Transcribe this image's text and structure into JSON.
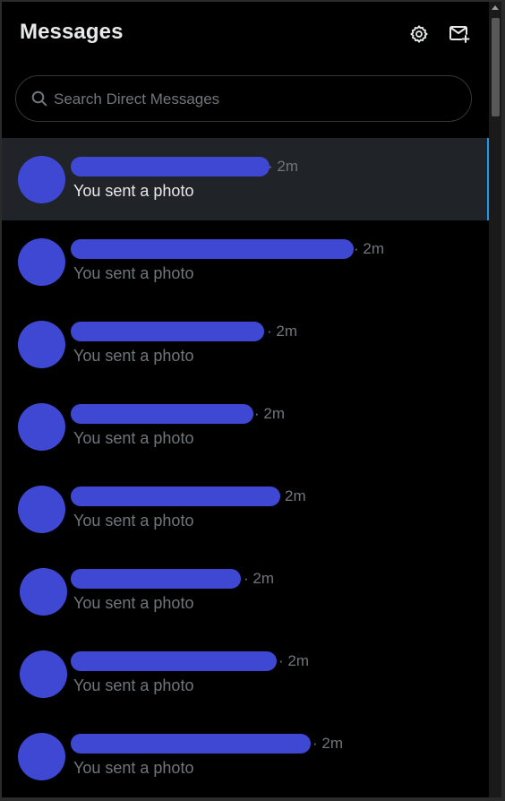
{
  "header": {
    "title": "Messages",
    "settings_icon": "gear-icon",
    "new_message_icon": "new-message-icon"
  },
  "search": {
    "placeholder": "Search Direct Messages",
    "icon": "search-icon"
  },
  "conversations": [
    {
      "time": "· 2m",
      "preview": "You sent a photo",
      "selected": true
    },
    {
      "time": "· 2m",
      "preview": "You sent a photo",
      "selected": false
    },
    {
      "time": "· 2m",
      "preview": "You sent a photo",
      "selected": false
    },
    {
      "time": "· 2m",
      "preview": "You sent a photo",
      "selected": false
    },
    {
      "time": "2m",
      "preview": "You sent a photo",
      "selected": false
    },
    {
      "time": "· 2m",
      "preview": "You sent a photo",
      "selected": false
    },
    {
      "time": "· 2m",
      "preview": "You sent a photo",
      "selected": false
    },
    {
      "time": "· 2m",
      "preview": "You sent a photo",
      "selected": false
    }
  ],
  "colors": {
    "background": "#000000",
    "selected_row": "#202327",
    "accent": "#1d9bf0",
    "redaction": "#3f48d3",
    "secondary_text": "#71767b",
    "primary_text": "#e7e9ea"
  }
}
